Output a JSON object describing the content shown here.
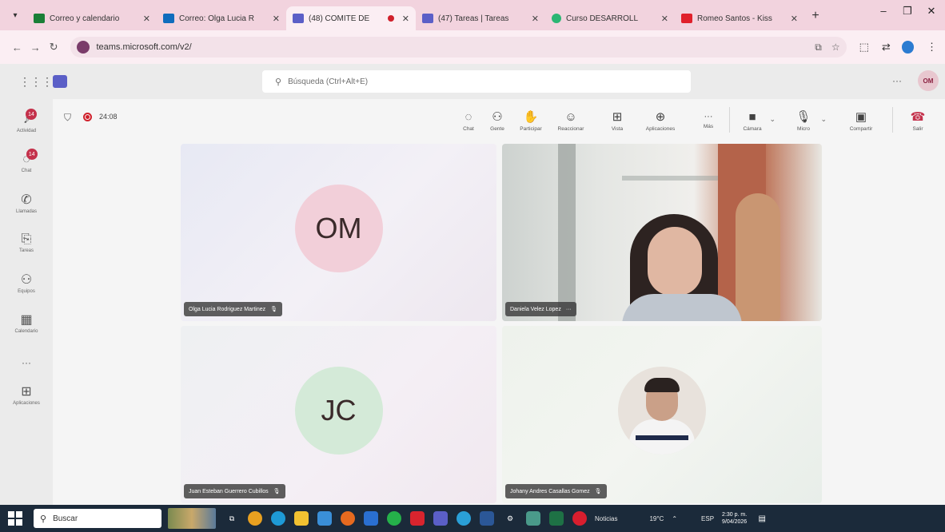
{
  "browser": {
    "tabs": [
      {
        "title": "Correo y calendario",
        "color": "#1a7f37"
      },
      {
        "title": "Correo: Olga Lucia R",
        "color": "#0f6cbd"
      },
      {
        "title": "(48) COMITE DE",
        "color": "#5b5fc7",
        "active": true
      },
      {
        "title": "(47) Tareas | Tareas",
        "color": "#5b5fc7"
      },
      {
        "title": "Curso DESARROLL",
        "color": "#2bb673"
      },
      {
        "title": "Romeo Santos - Kiss",
        "color": "#e0202b"
      }
    ],
    "url": "teams.microsoft.com/v2/"
  },
  "teams": {
    "search_placeholder": "Búsqueda (Ctrl+Alt+E)",
    "user_initials": "OM"
  },
  "rail": [
    {
      "label": "Actividad",
      "icon": "bell-icon",
      "badge": "14"
    },
    {
      "label": "Chat",
      "icon": "chat-icon",
      "badge": "14"
    },
    {
      "label": "Llamadas",
      "icon": "phone-icon"
    },
    {
      "label": "Tareas",
      "icon": "clipboard-icon"
    },
    {
      "label": "Equipos",
      "icon": "teams-icon"
    },
    {
      "label": "Calendario",
      "icon": "calendar-icon"
    },
    {
      "label": "",
      "icon": "more-icon"
    },
    {
      "label": "Aplicaciones",
      "icon": "apps-icon"
    }
  ],
  "meeting": {
    "timer": "24:08",
    "toolbar": [
      {
        "label": "Chat",
        "icon": "chat-icon"
      },
      {
        "label": "Gente",
        "icon": "people-icon"
      },
      {
        "label": "Participar",
        "icon": "raise-hand-icon"
      },
      {
        "label": "Reaccionar",
        "icon": "emoji-icon"
      },
      {
        "label": "Vista",
        "icon": "grid-view-icon"
      },
      {
        "label": "Aplicaciones",
        "icon": "add-apps-icon"
      },
      {
        "label": "Más",
        "icon": "more-icon"
      },
      {
        "label": "Cámara",
        "icon": "camera-off-icon"
      },
      {
        "label": "Micro",
        "icon": "mic-off-icon"
      },
      {
        "label": "Compartir",
        "icon": "share-icon"
      },
      {
        "label": "Salir",
        "icon": "hang-up-icon"
      }
    ],
    "participants": [
      {
        "name": "Olga Lucia Rodriguez Martinez",
        "initials": "OM"
      },
      {
        "name": "Daniela Velez Lopez"
      },
      {
        "name": "Juan Esteban Guerrero Cubillos",
        "initials": "JC"
      },
      {
        "name": "Johany Andres Casallas Gomez"
      }
    ]
  },
  "taskbar": {
    "search_label": "Buscar",
    "news": "Noticias",
    "weather": "19°C",
    "lang": "ESP",
    "time": "2:30 p. m.",
    "date": "9/04/2026"
  }
}
